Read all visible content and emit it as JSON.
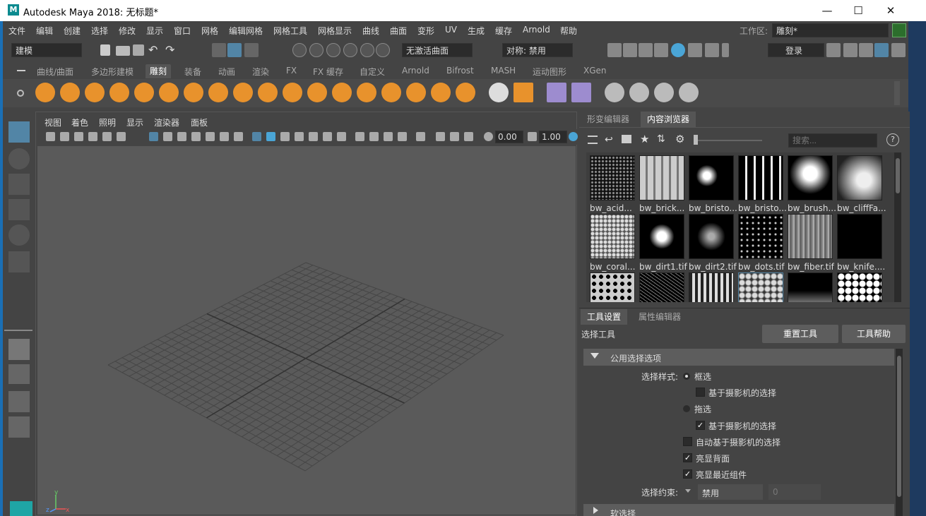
{
  "window": {
    "title": "Autodesk Maya 2018: 无标题*",
    "logo": "M",
    "minimize": "—",
    "maximize": "☐",
    "close": "✕"
  },
  "menu": [
    "文件",
    "编辑",
    "创建",
    "选择",
    "修改",
    "显示",
    "窗口",
    "网格",
    "编辑网格",
    "网格工具",
    "网格显示",
    "曲线",
    "曲面",
    "变形",
    "UV",
    "生成",
    "缓存",
    "Arnold",
    "帮助"
  ],
  "workspace": {
    "label": "工作区:",
    "value": "雕刻*"
  },
  "statusline": {
    "mode": "建模",
    "live_surface": "无激活曲面",
    "symmetry": "对称: 禁用",
    "login": "登录"
  },
  "shelf_tabs": [
    "曲线/曲面",
    "多边形建模",
    "雕刻",
    "装备",
    "动画",
    "渲染",
    "FX",
    "FX 缓存",
    "自定义",
    "Arnold",
    "Bifrost",
    "MASH",
    "运动图形",
    "XGen"
  ],
  "active_shelf_tab": "雕刻",
  "viewport": {
    "menu": [
      "视图",
      "着色",
      "照明",
      "显示",
      "渲染器",
      "面板"
    ],
    "exposure": "0.00",
    "gamma": "1.00",
    "axis_labels": {
      "x": "x",
      "y": "y",
      "z": "z"
    }
  },
  "right_tabs": {
    "top": [
      "形变编辑器",
      "内容浏览器"
    ],
    "top_active": "内容浏览器",
    "bottom": [
      "工具设置",
      "属性编辑器"
    ],
    "bottom_active": "工具设置"
  },
  "content_browser": {
    "search_placeholder": "搜索...",
    "help": "?",
    "thumbnails": [
      {
        "label": "bw_acid..."
      },
      {
        "label": "bw_brick..."
      },
      {
        "label": "bw_bristo..."
      },
      {
        "label": "bw_bristo..."
      },
      {
        "label": "bw_brush..."
      },
      {
        "label": "bw_cliffFa..."
      },
      {
        "label": "bw_coral..."
      },
      {
        "label": "bw_dirt1.tif"
      },
      {
        "label": "bw_dirt2.tif"
      },
      {
        "label": "bw_dots.tif"
      },
      {
        "label": "bw_fiber.tif"
      },
      {
        "label": "bw_knife...."
      },
      {
        "label": ""
      },
      {
        "label": ""
      },
      {
        "label": ""
      },
      {
        "label": ""
      },
      {
        "label": ""
      },
      {
        "label": ""
      }
    ]
  },
  "tool_settings": {
    "tool_name": "选择工具",
    "reset_btn": "重置工具",
    "help_btn": "工具帮助",
    "section": "公用选择选项",
    "select_style_label": "选择样式:",
    "marquee": "框选",
    "camera_based_1": "基于摄影机的选择",
    "drag": "拖选",
    "camera_based_2": "基于摄影机的选择",
    "auto_camera": "自动基于摄影机的选择",
    "highlight_backface": "亮显背面",
    "highlight_nearest": "亮显最近组件",
    "constraint_label": "选择约束:",
    "constraint_value": "禁用",
    "constraint_num": "0",
    "next_section": "软选择"
  },
  "colors": {
    "accent": "#5285a6",
    "shelf_orange": "#e8922c",
    "brand": "#0b8a8f"
  }
}
